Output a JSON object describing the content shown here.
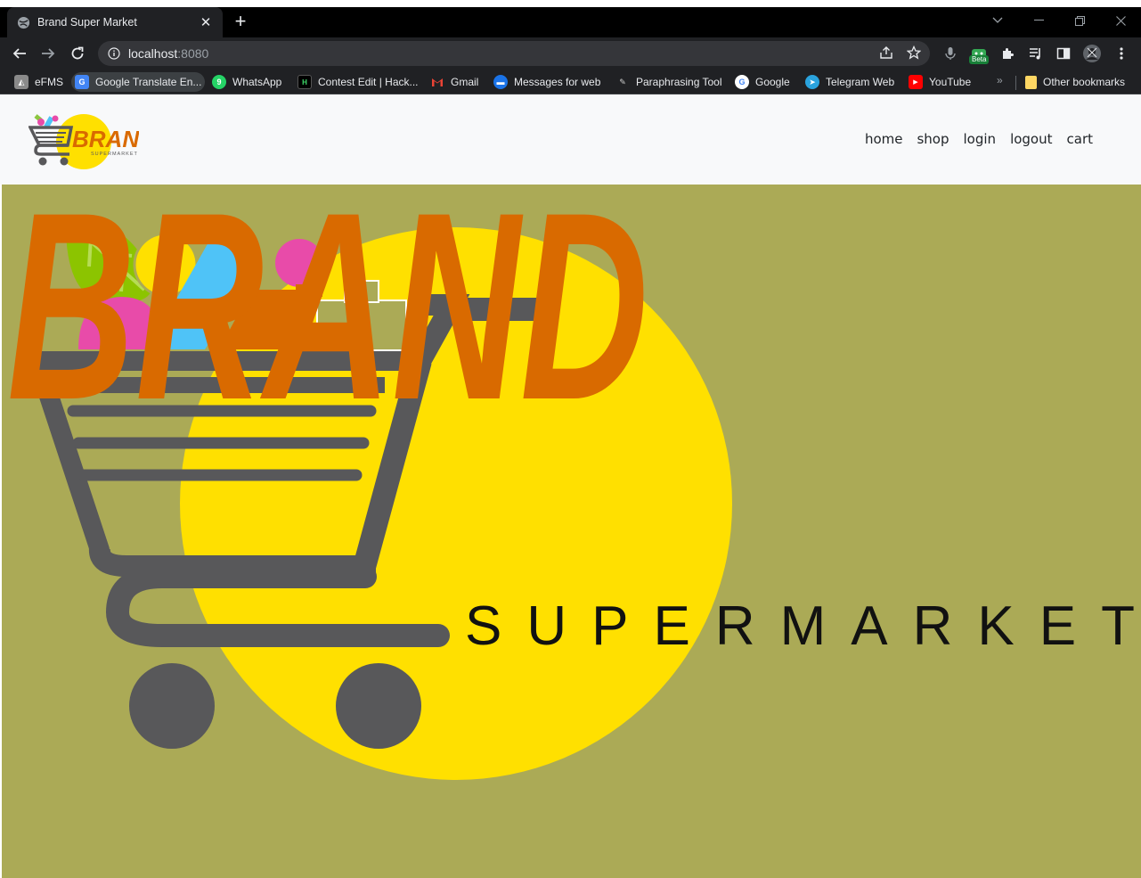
{
  "browser": {
    "tab_title": "Brand Super Market",
    "url_host": "localhost",
    "url_port": ":8080",
    "beta_label": "Beta",
    "bookmarks": [
      {
        "label": "eFMS",
        "icon": "efms-icon"
      },
      {
        "label": "Google Translate En...",
        "icon": "google-translate-icon"
      },
      {
        "label": "WhatsApp",
        "icon": "whatsapp-icon"
      },
      {
        "label": "Contest Edit | Hack...",
        "icon": "hackerearth-icon"
      },
      {
        "label": "Gmail",
        "icon": "gmail-icon"
      },
      {
        "label": "Messages for web",
        "icon": "messages-icon"
      },
      {
        "label": "Paraphrasing Tool",
        "icon": "quillbot-icon"
      },
      {
        "label": "Google",
        "icon": "google-icon"
      },
      {
        "label": "Telegram Web",
        "icon": "telegram-icon"
      },
      {
        "label": "YouTube",
        "icon": "youtube-icon"
      }
    ],
    "other_bookmarks": "Other bookmarks",
    "more_bookmarks": "»"
  },
  "nav": {
    "logo_brand": "BRAND",
    "logo_sub": "SUPERMARKET",
    "links": [
      "home",
      "shop",
      "login",
      "logout",
      "cart"
    ]
  },
  "hero": {
    "brand": "BRAND",
    "tagline": "SUPERMARKET"
  },
  "colors": {
    "hero_bg": "#abaa56",
    "brand_orange": "#d96a00",
    "circle_yellow": "#ffe000",
    "cart_gray": "#58585a",
    "navbar_bg": "#f8f9fa"
  }
}
